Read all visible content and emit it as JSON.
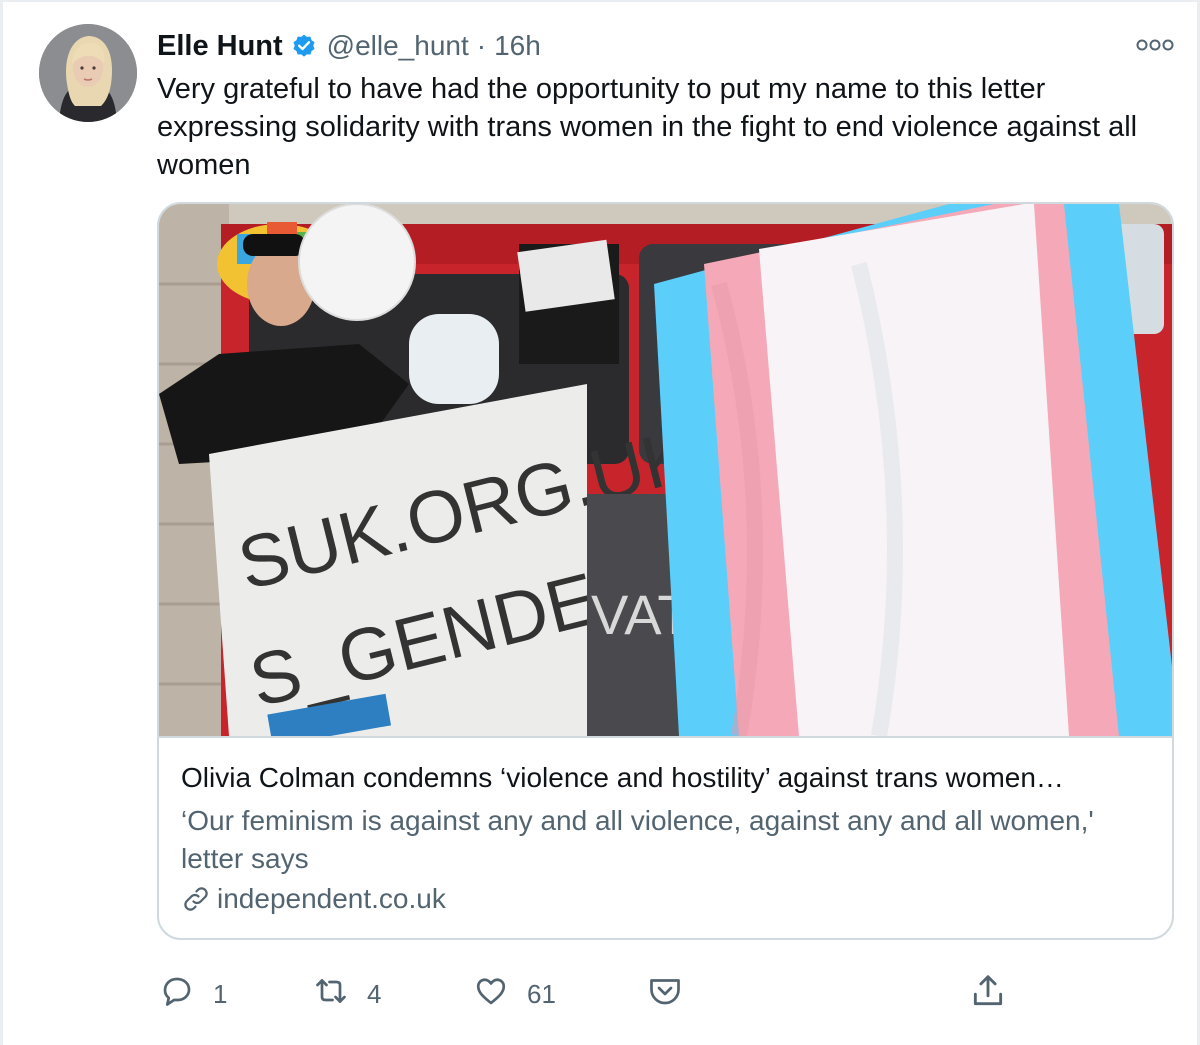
{
  "tweet": {
    "author_name": "Elle Hunt",
    "handle": "@elle_hunt",
    "separator": "·",
    "time": "16h",
    "text": "Very grateful to have had the opportunity to put my name to this letter expressing solidarity with trans women in the fight to end violence against all women"
  },
  "card": {
    "title": "Olivia Colman condemns ‘violence and hostility’ against trans women…",
    "description": "‘Our feminism is against any and all violence, against any and all women,' letter says",
    "domain": "independent.co.uk",
    "banner_text_line1": "SUK.ORG.UK",
    "banner_text_line2": "S_GENDER",
    "bus_sign_text": "VAT IRE"
  },
  "actions": {
    "reply_count": "1",
    "retweet_count": "4",
    "like_count": "61"
  },
  "icons": {
    "verified": "verified-badge-icon",
    "more": "more-options-icon",
    "reply": "reply-icon",
    "retweet": "retweet-icon",
    "like": "heart-icon",
    "bookmark": "bookmark-pocket-icon",
    "share": "share-icon",
    "link": "link-icon"
  },
  "colors": {
    "verified_blue": "#1d9bf0",
    "secondary_text": "#536471",
    "primary_text": "#0f1419",
    "border": "#cfd9de",
    "trans_blue": "#5bcefa",
    "trans_pink": "#f5a9b8",
    "bus_red": "#c8242b"
  }
}
